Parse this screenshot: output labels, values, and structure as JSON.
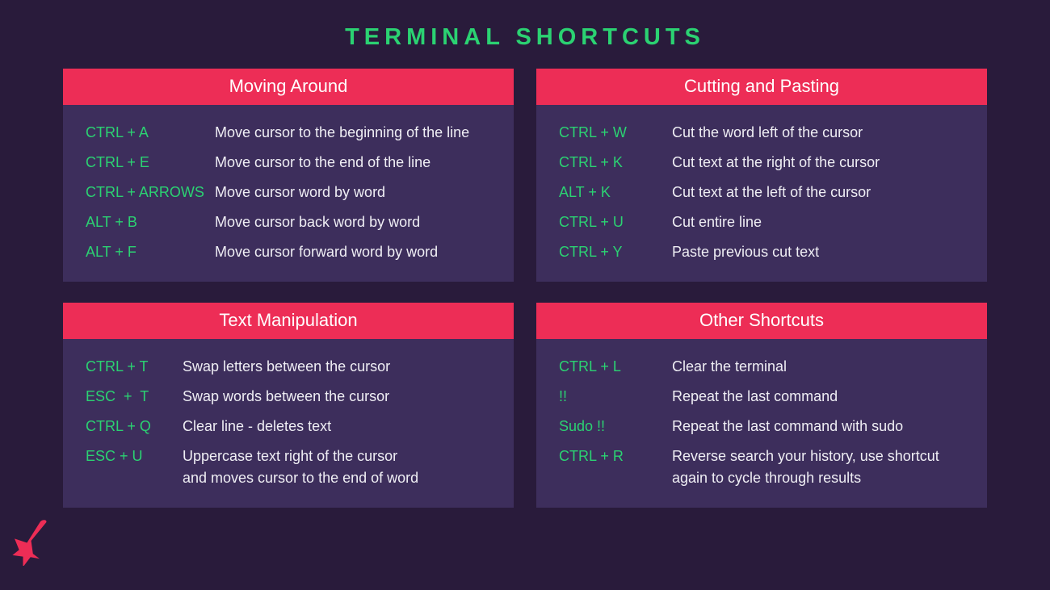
{
  "colors": {
    "background": "#291b3b",
    "card": "#3d2e5c",
    "header": "#ed2d56",
    "accent": "#2bd272",
    "text": "#efeef4"
  },
  "title": "TERMINAL  SHORTCUTS",
  "sections": [
    {
      "title": "Moving Around",
      "keyWidthClass": "",
      "rows": [
        {
          "key": "CTRL + A",
          "desc": "Move cursor to the beginning of the line"
        },
        {
          "key": "CTRL + E",
          "desc": "Move cursor to the end of the line"
        },
        {
          "key": "CTRL + ARROWS",
          "desc": "Move cursor word by word"
        },
        {
          "key": "ALT + B",
          "desc": "Move cursor back word by word"
        },
        {
          "key": "ALT + F",
          "desc": "Move cursor forward word by word"
        }
      ]
    },
    {
      "title": "Cutting and Pasting",
      "keyWidthClass": "wide",
      "rows": [
        {
          "key": "CTRL + W",
          "desc": "Cut the word left of the cursor"
        },
        {
          "key": "CTRL + K",
          "desc": "Cut text at the right of the cursor"
        },
        {
          "key": "ALT + K",
          "desc": "Cut text at the left of the cursor"
        },
        {
          "key": "CTRL + U",
          "desc": "Cut entire line"
        },
        {
          "key": "CTRL + Y",
          "desc": "Paste previous cut text"
        }
      ]
    },
    {
      "title": "Text Manipulation",
      "keyWidthClass": "narrow",
      "rows": [
        {
          "key": "CTRL + T",
          "desc": "Swap letters between the cursor"
        },
        {
          "key": "ESC  +  T",
          "desc": "Swap words between the cursor"
        },
        {
          "key": "CTRL + Q",
          "desc": "Clear line - deletes text"
        },
        {
          "key": "ESC + U",
          "desc": "Uppercase text right of the cursor\nand moves cursor to the end of word"
        }
      ]
    },
    {
      "title": "Other Shortcuts",
      "keyWidthClass": "wide",
      "rows": [
        {
          "key": "CTRL + L",
          "desc": "Clear the terminal"
        },
        {
          "key": "!!",
          "desc": "Repeat the last command"
        },
        {
          "key": "Sudo !!",
          "desc": "Repeat the last command with sudo"
        },
        {
          "key": "CTRL + R",
          "desc": "Reverse search your history, use shortcut again to cycle through results"
        }
      ]
    }
  ]
}
